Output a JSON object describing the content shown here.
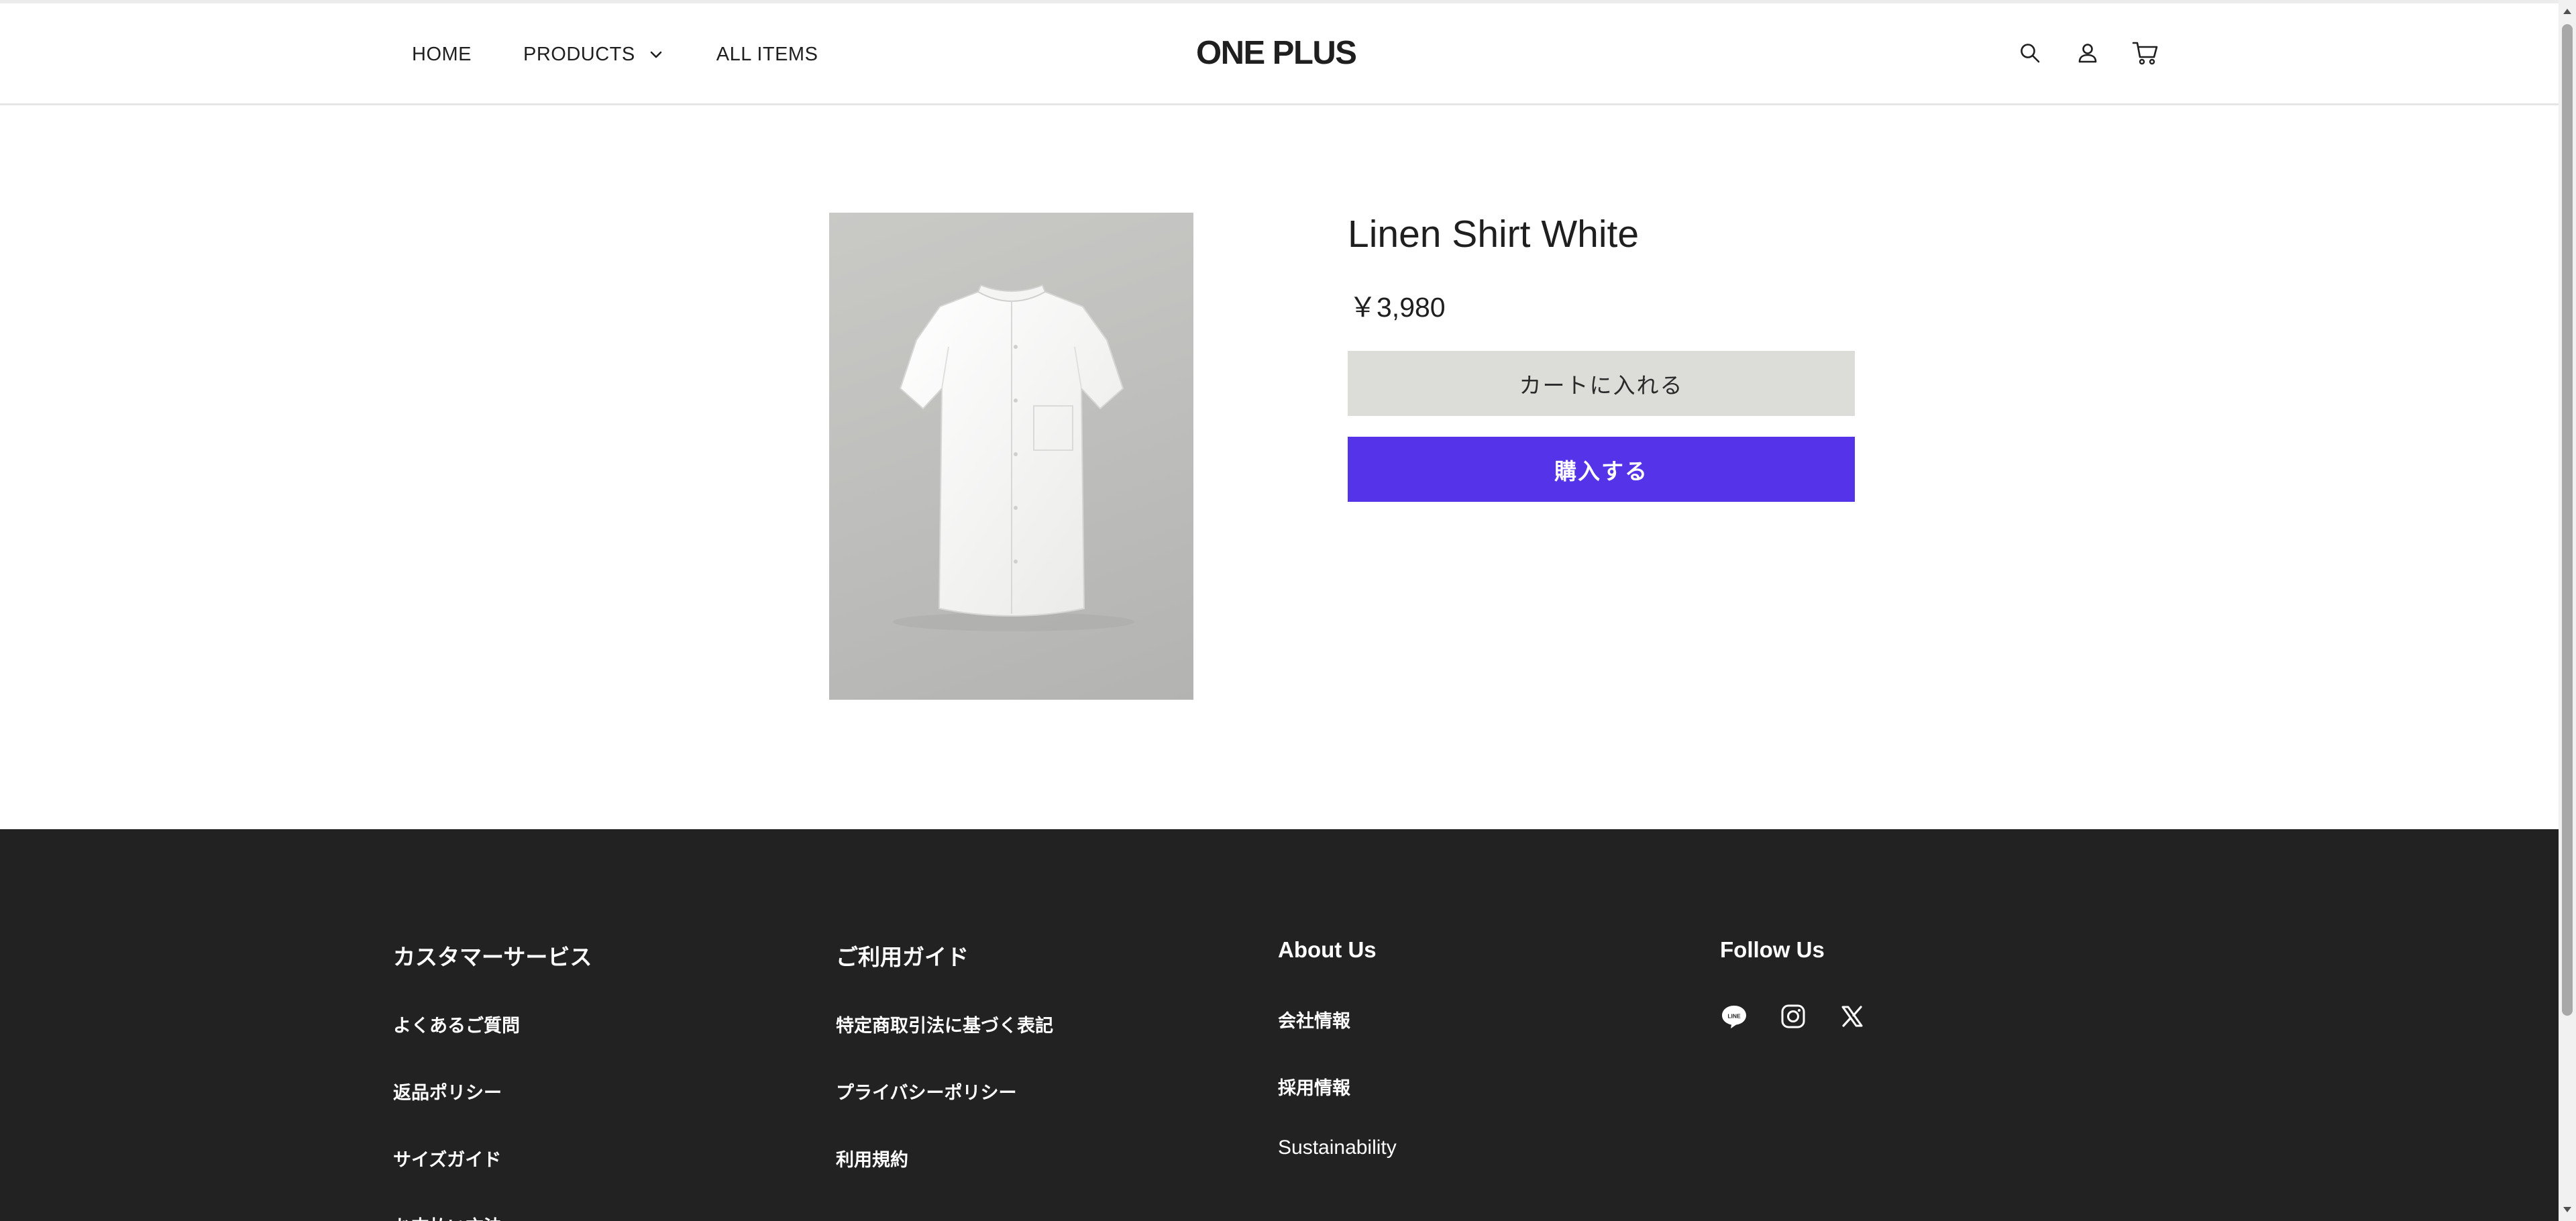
{
  "header": {
    "nav": [
      {
        "label": "HOME"
      },
      {
        "label": "PRODUCTS",
        "has_dropdown": true
      },
      {
        "label": "ALL ITEMS"
      }
    ],
    "logo": "ONE PLUS",
    "icons": [
      "search-icon",
      "account-icon",
      "cart-icon"
    ]
  },
  "product": {
    "title": "Linen Shirt White",
    "price": "￥3,980",
    "add_to_cart_label": "カートに入れる",
    "buy_now_label": "購入する",
    "image_description": "white short-sleeve linen shirt"
  },
  "footer": {
    "columns": [
      {
        "title": "カスタマーサービス",
        "links": [
          "よくあるご質問",
          "返品ポリシー",
          "サイズガイド",
          "お支払い方法"
        ]
      },
      {
        "title": "ご利用ガイド",
        "links": [
          "特定商取引法に基づく表記",
          "プライバシーポリシー",
          "利用規約"
        ]
      },
      {
        "title": "About Us",
        "links": [
          "会社情報",
          "採用情報",
          "Sustainability"
        ]
      },
      {
        "title": "Follow Us",
        "social": [
          "line-icon",
          "instagram-icon",
          "x-icon"
        ]
      }
    ]
  },
  "colors": {
    "accent": "#5533e8",
    "cart_button": "#dcdcd8",
    "footer_bg": "#222222"
  }
}
